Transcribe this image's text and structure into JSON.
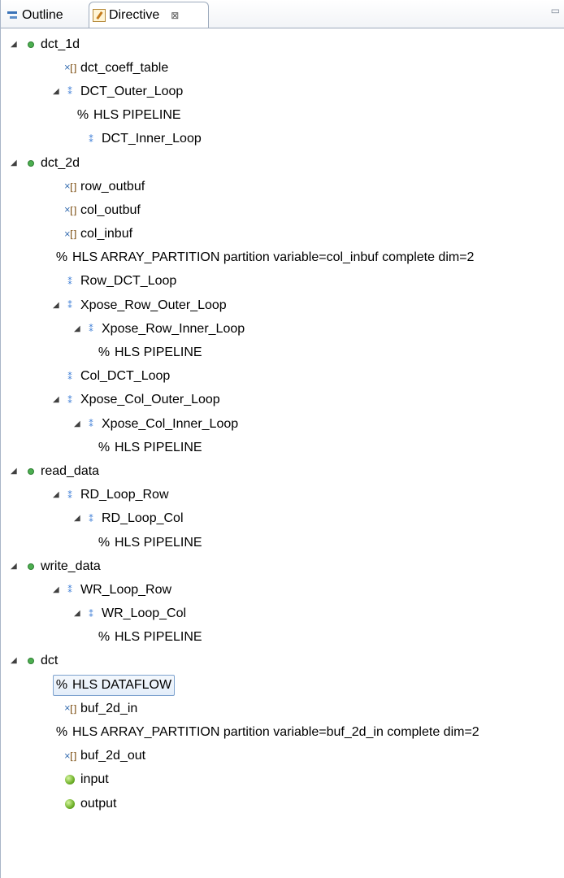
{
  "tabs": [
    {
      "label": "Outline",
      "icon": "outline-icon"
    },
    {
      "label": "Directive",
      "icon": "directive-icon",
      "close": "⊠"
    }
  ],
  "tree": [
    {
      "label": "dct_1d",
      "kind": "function",
      "depth": 0,
      "expanded": true
    },
    {
      "label": "dct_coeff_table",
      "kind": "variable",
      "depth": 1
    },
    {
      "label": "DCT_Outer_Loop",
      "kind": "loop",
      "depth": 1,
      "expanded": true
    },
    {
      "label": "HLS PIPELINE",
      "kind": "directive",
      "depth": 2
    },
    {
      "label": "DCT_Inner_Loop",
      "kind": "loop",
      "depth": 2
    },
    {
      "label": "dct_2d",
      "kind": "function",
      "depth": 0,
      "expanded": true
    },
    {
      "label": "row_outbuf",
      "kind": "variable",
      "depth": 1
    },
    {
      "label": "col_outbuf",
      "kind": "variable",
      "depth": 1
    },
    {
      "label": "col_inbuf",
      "kind": "variable",
      "depth": 1
    },
    {
      "label": "HLS ARRAY_PARTITION partition variable=col_inbuf complete dim=2",
      "kind": "directive",
      "depth": 1
    },
    {
      "label": "Row_DCT_Loop",
      "kind": "loop",
      "depth": 1
    },
    {
      "label": "Xpose_Row_Outer_Loop",
      "kind": "loop",
      "depth": 1,
      "expanded": true
    },
    {
      "label": "Xpose_Row_Inner_Loop",
      "kind": "loop",
      "depth": 2,
      "expanded": true
    },
    {
      "label": "HLS PIPELINE",
      "kind": "directive",
      "depth": 3
    },
    {
      "label": "Col_DCT_Loop",
      "kind": "loop",
      "depth": 1
    },
    {
      "label": "Xpose_Col_Outer_Loop",
      "kind": "loop",
      "depth": 1,
      "expanded": true
    },
    {
      "label": "Xpose_Col_Inner_Loop",
      "kind": "loop",
      "depth": 2,
      "expanded": true
    },
    {
      "label": "HLS PIPELINE",
      "kind": "directive",
      "depth": 3
    },
    {
      "label": "read_data",
      "kind": "function",
      "depth": 0,
      "expanded": true
    },
    {
      "label": "RD_Loop_Row",
      "kind": "loop",
      "depth": 1,
      "expanded": true
    },
    {
      "label": "RD_Loop_Col",
      "kind": "loop",
      "depth": 2,
      "expanded": true
    },
    {
      "label": "HLS PIPELINE",
      "kind": "directive",
      "depth": 3
    },
    {
      "label": "write_data",
      "kind": "function",
      "depth": 0,
      "expanded": true
    },
    {
      "label": "WR_Loop_Row",
      "kind": "loop",
      "depth": 1,
      "expanded": true
    },
    {
      "label": "WR_Loop_Col",
      "kind": "loop",
      "depth": 2,
      "expanded": true
    },
    {
      "label": "HLS PIPELINE",
      "kind": "directive",
      "depth": 3
    },
    {
      "label": "dct",
      "kind": "function",
      "depth": 0,
      "expanded": true
    },
    {
      "label": "HLS DATAFLOW",
      "kind": "directive",
      "depth": 1,
      "selected": true
    },
    {
      "label": "buf_2d_in",
      "kind": "variable",
      "depth": 1
    },
    {
      "label": "HLS ARRAY_PARTITION partition variable=buf_2d_in complete dim=2",
      "kind": "directive",
      "depth": 1
    },
    {
      "label": "buf_2d_out",
      "kind": "variable",
      "depth": 1
    },
    {
      "label": "input",
      "kind": "port",
      "depth": 1
    },
    {
      "label": "output",
      "kind": "port",
      "depth": 1
    }
  ]
}
